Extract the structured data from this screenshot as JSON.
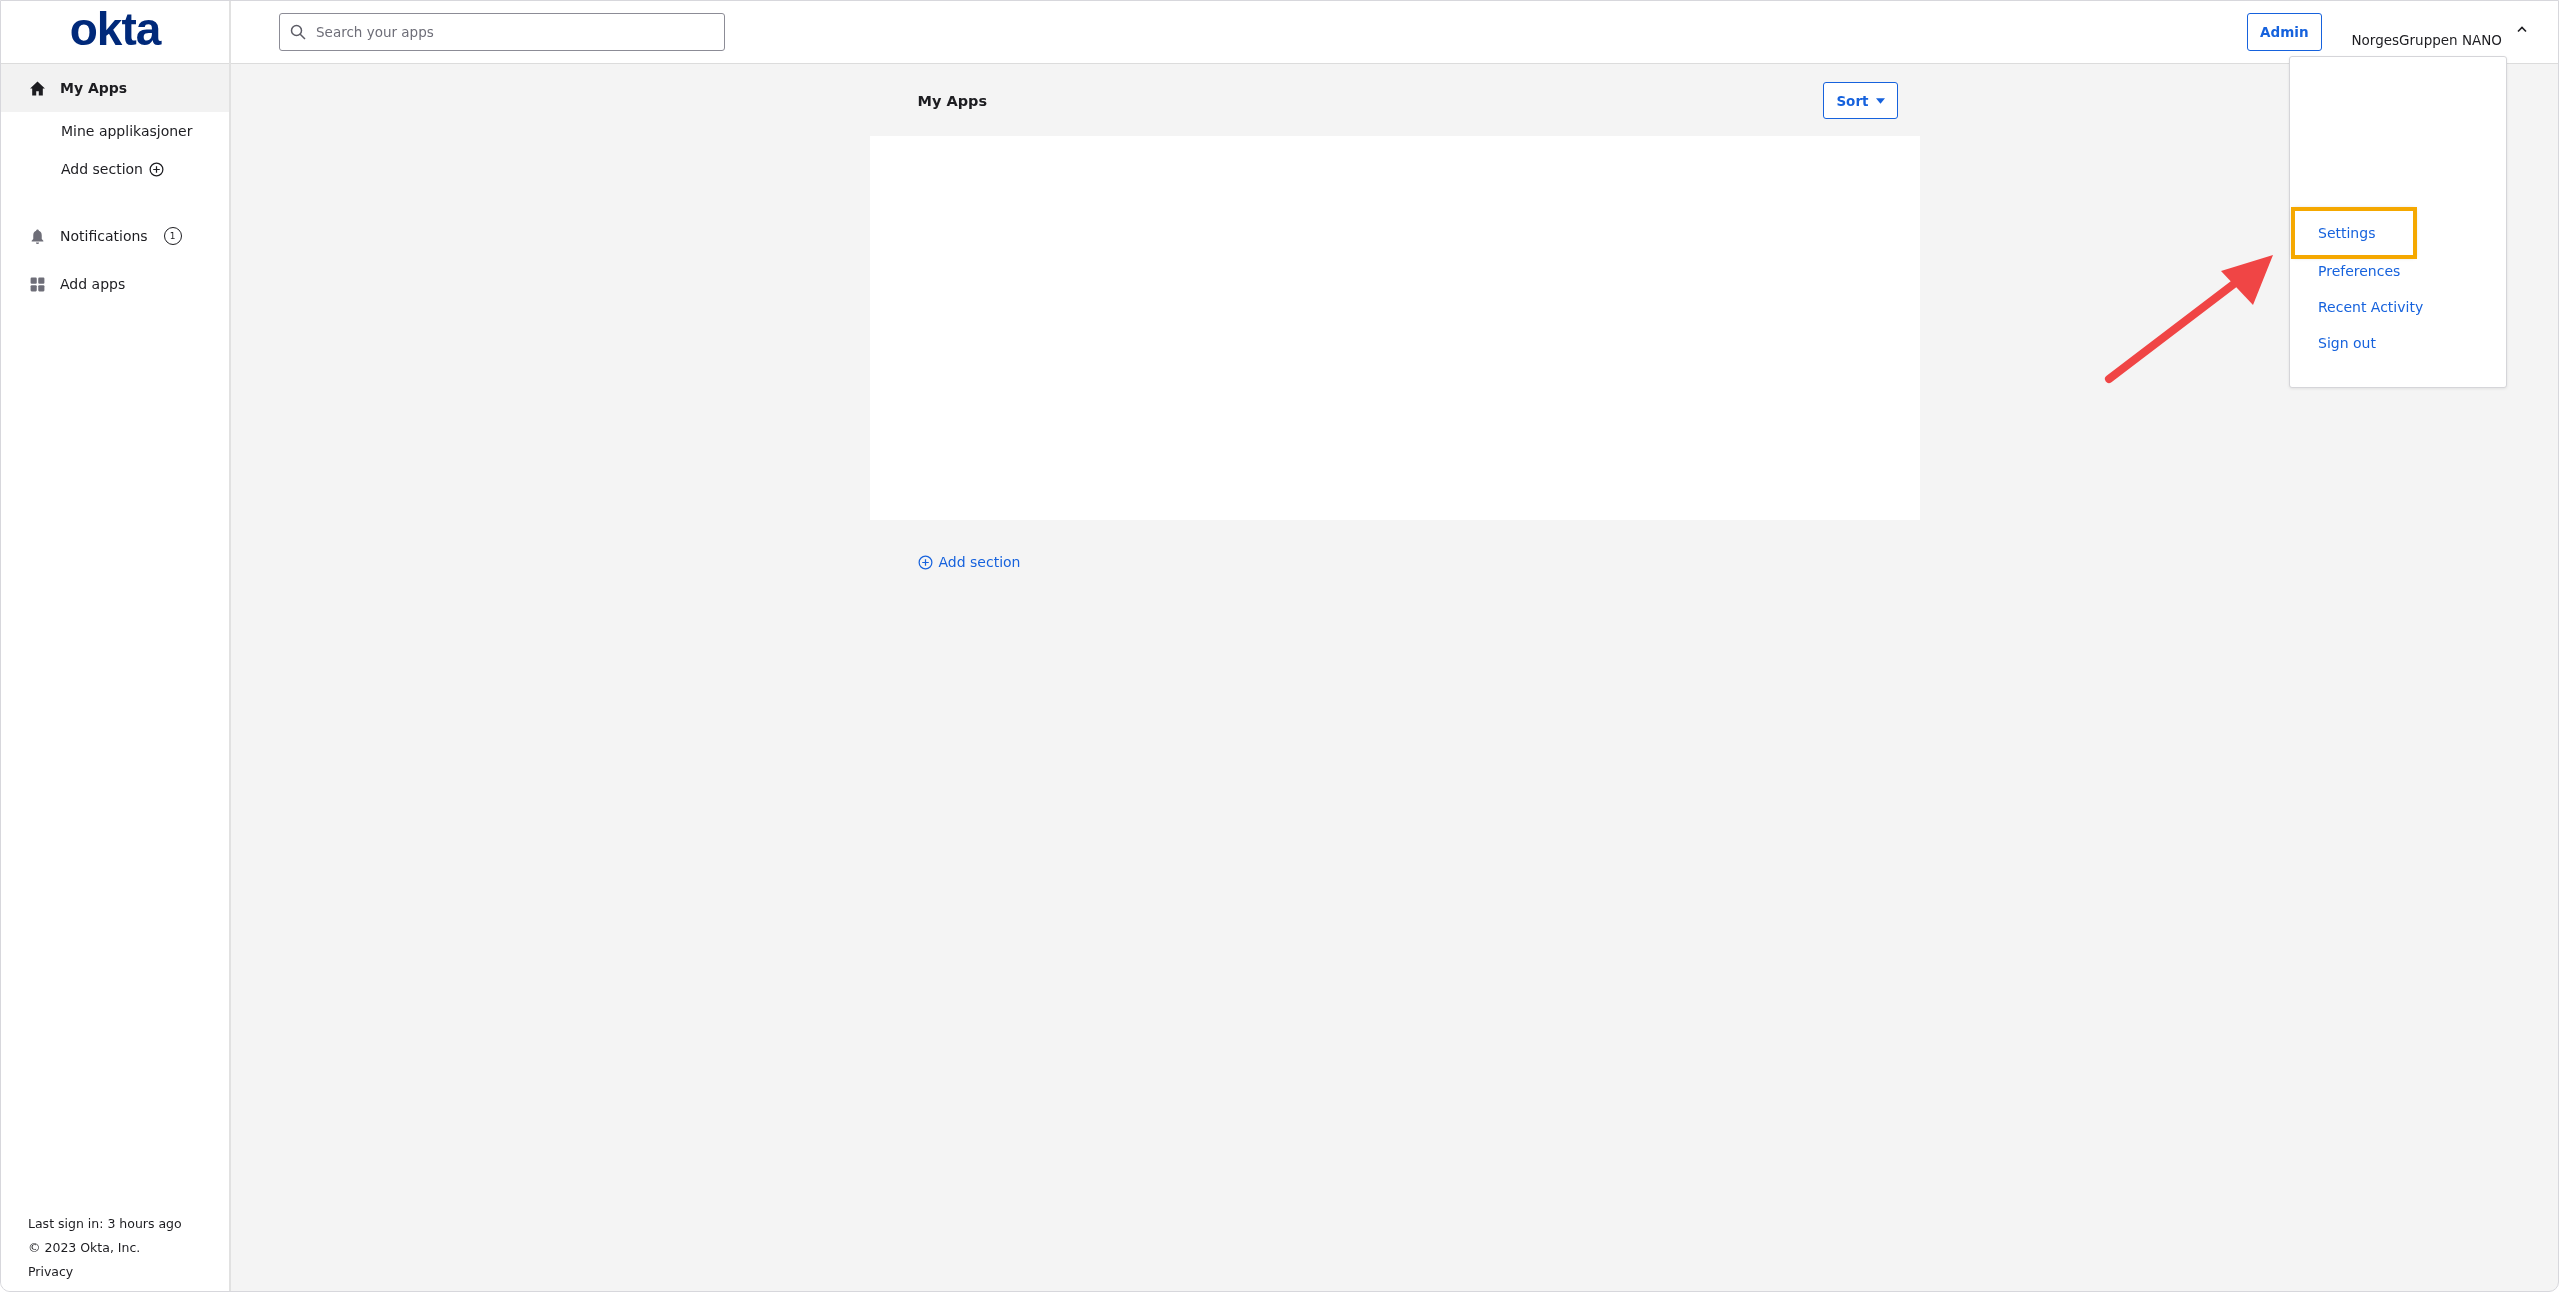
{
  "logo": "okta",
  "search": {
    "placeholder": "Search your apps"
  },
  "header": {
    "admin_button": "Admin",
    "user_name": "NorgesGruppen NANO",
    "menu_expanded": true
  },
  "user_menu": [
    {
      "label": "Settings",
      "highlighted": true
    },
    {
      "label": "Preferences",
      "highlighted": false
    },
    {
      "label": "Recent Activity",
      "highlighted": false
    },
    {
      "label": "Sign out",
      "highlighted": false
    }
  ],
  "sidebar": {
    "items": [
      {
        "kind": "home",
        "label": "My Apps",
        "selected": true
      },
      {
        "kind": "sub",
        "label": "Mine applikasjoner",
        "selected": false
      },
      {
        "kind": "add",
        "label": "Add section",
        "selected": false
      },
      {
        "kind": "bell",
        "label": "Notifications",
        "badge": "1",
        "selected": false
      },
      {
        "kind": "grid",
        "label": "Add apps",
        "selected": false
      }
    ],
    "footer": [
      "Last sign in: 3 hours ago",
      "© 2023 Okta, Inc.",
      "Privacy"
    ]
  },
  "main": {
    "title": "My Apps",
    "sort_button": "Sort",
    "add_section": "Add section"
  }
}
